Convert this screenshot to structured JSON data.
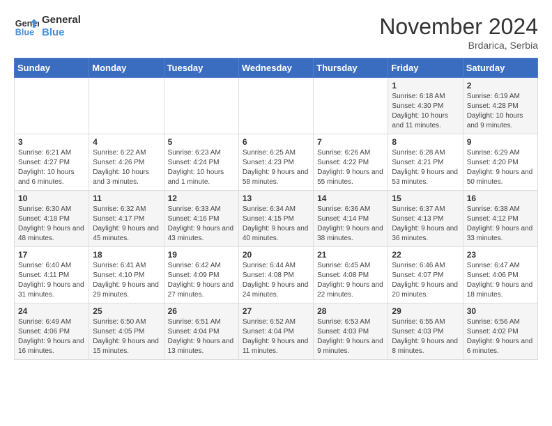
{
  "logo": {
    "line1": "General",
    "line2": "Blue"
  },
  "title": "November 2024",
  "location": "Brdarica, Serbia",
  "weekdays": [
    "Sunday",
    "Monday",
    "Tuesday",
    "Wednesday",
    "Thursday",
    "Friday",
    "Saturday"
  ],
  "weeks": [
    [
      {
        "day": "",
        "info": ""
      },
      {
        "day": "",
        "info": ""
      },
      {
        "day": "",
        "info": ""
      },
      {
        "day": "",
        "info": ""
      },
      {
        "day": "",
        "info": ""
      },
      {
        "day": "1",
        "info": "Sunrise: 6:18 AM\nSunset: 4:30 PM\nDaylight: 10 hours and 11 minutes."
      },
      {
        "day": "2",
        "info": "Sunrise: 6:19 AM\nSunset: 4:28 PM\nDaylight: 10 hours and 9 minutes."
      }
    ],
    [
      {
        "day": "3",
        "info": "Sunrise: 6:21 AM\nSunset: 4:27 PM\nDaylight: 10 hours and 6 minutes."
      },
      {
        "day": "4",
        "info": "Sunrise: 6:22 AM\nSunset: 4:26 PM\nDaylight: 10 hours and 3 minutes."
      },
      {
        "day": "5",
        "info": "Sunrise: 6:23 AM\nSunset: 4:24 PM\nDaylight: 10 hours and 1 minute."
      },
      {
        "day": "6",
        "info": "Sunrise: 6:25 AM\nSunset: 4:23 PM\nDaylight: 9 hours and 58 minutes."
      },
      {
        "day": "7",
        "info": "Sunrise: 6:26 AM\nSunset: 4:22 PM\nDaylight: 9 hours and 55 minutes."
      },
      {
        "day": "8",
        "info": "Sunrise: 6:28 AM\nSunset: 4:21 PM\nDaylight: 9 hours and 53 minutes."
      },
      {
        "day": "9",
        "info": "Sunrise: 6:29 AM\nSunset: 4:20 PM\nDaylight: 9 hours and 50 minutes."
      }
    ],
    [
      {
        "day": "10",
        "info": "Sunrise: 6:30 AM\nSunset: 4:18 PM\nDaylight: 9 hours and 48 minutes."
      },
      {
        "day": "11",
        "info": "Sunrise: 6:32 AM\nSunset: 4:17 PM\nDaylight: 9 hours and 45 minutes."
      },
      {
        "day": "12",
        "info": "Sunrise: 6:33 AM\nSunset: 4:16 PM\nDaylight: 9 hours and 43 minutes."
      },
      {
        "day": "13",
        "info": "Sunrise: 6:34 AM\nSunset: 4:15 PM\nDaylight: 9 hours and 40 minutes."
      },
      {
        "day": "14",
        "info": "Sunrise: 6:36 AM\nSunset: 4:14 PM\nDaylight: 9 hours and 38 minutes."
      },
      {
        "day": "15",
        "info": "Sunrise: 6:37 AM\nSunset: 4:13 PM\nDaylight: 9 hours and 36 minutes."
      },
      {
        "day": "16",
        "info": "Sunrise: 6:38 AM\nSunset: 4:12 PM\nDaylight: 9 hours and 33 minutes."
      }
    ],
    [
      {
        "day": "17",
        "info": "Sunrise: 6:40 AM\nSunset: 4:11 PM\nDaylight: 9 hours and 31 minutes."
      },
      {
        "day": "18",
        "info": "Sunrise: 6:41 AM\nSunset: 4:10 PM\nDaylight: 9 hours and 29 minutes."
      },
      {
        "day": "19",
        "info": "Sunrise: 6:42 AM\nSunset: 4:09 PM\nDaylight: 9 hours and 27 minutes."
      },
      {
        "day": "20",
        "info": "Sunrise: 6:44 AM\nSunset: 4:08 PM\nDaylight: 9 hours and 24 minutes."
      },
      {
        "day": "21",
        "info": "Sunrise: 6:45 AM\nSunset: 4:08 PM\nDaylight: 9 hours and 22 minutes."
      },
      {
        "day": "22",
        "info": "Sunrise: 6:46 AM\nSunset: 4:07 PM\nDaylight: 9 hours and 20 minutes."
      },
      {
        "day": "23",
        "info": "Sunrise: 6:47 AM\nSunset: 4:06 PM\nDaylight: 9 hours and 18 minutes."
      }
    ],
    [
      {
        "day": "24",
        "info": "Sunrise: 6:49 AM\nSunset: 4:06 PM\nDaylight: 9 hours and 16 minutes."
      },
      {
        "day": "25",
        "info": "Sunrise: 6:50 AM\nSunset: 4:05 PM\nDaylight: 9 hours and 15 minutes."
      },
      {
        "day": "26",
        "info": "Sunrise: 6:51 AM\nSunset: 4:04 PM\nDaylight: 9 hours and 13 minutes."
      },
      {
        "day": "27",
        "info": "Sunrise: 6:52 AM\nSunset: 4:04 PM\nDaylight: 9 hours and 11 minutes."
      },
      {
        "day": "28",
        "info": "Sunrise: 6:53 AM\nSunset: 4:03 PM\nDaylight: 9 hours and 9 minutes."
      },
      {
        "day": "29",
        "info": "Sunrise: 6:55 AM\nSunset: 4:03 PM\nDaylight: 9 hours and 8 minutes."
      },
      {
        "day": "30",
        "info": "Sunrise: 6:56 AM\nSunset: 4:02 PM\nDaylight: 9 hours and 6 minutes."
      }
    ]
  ]
}
